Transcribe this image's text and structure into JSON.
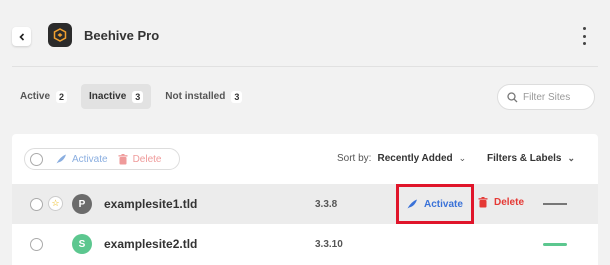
{
  "header": {
    "title": "Beehive Pro"
  },
  "tabs": [
    {
      "label": "Active",
      "count": "2"
    },
    {
      "label": "Inactive",
      "count": "3"
    },
    {
      "label": "Not installed",
      "count": "3"
    }
  ],
  "filter": {
    "placeholder": "Filter Sites"
  },
  "toolbar": {
    "activate_label": "Activate",
    "delete_label": "Delete",
    "sort_label": "Sort by:",
    "sort_value": "Recently Added",
    "filters_label": "Filters & Labels"
  },
  "sites": [
    {
      "avatar": "P",
      "name": "examplesite1.tld",
      "version": "3.3.8",
      "activate_label": "Activate",
      "delete_label": "Delete",
      "avatar_color": "#6b6b6b",
      "status_color": "#777777"
    },
    {
      "avatar": "S",
      "name": "examplesite2.tld",
      "version": "3.3.10",
      "avatar_color": "#5cc78f",
      "status_color": "#5cc78f"
    }
  ],
  "colors": {
    "accent_blue": "#3a72d8",
    "delete_red": "#e53935",
    "highlight_border": "#e0152a"
  }
}
